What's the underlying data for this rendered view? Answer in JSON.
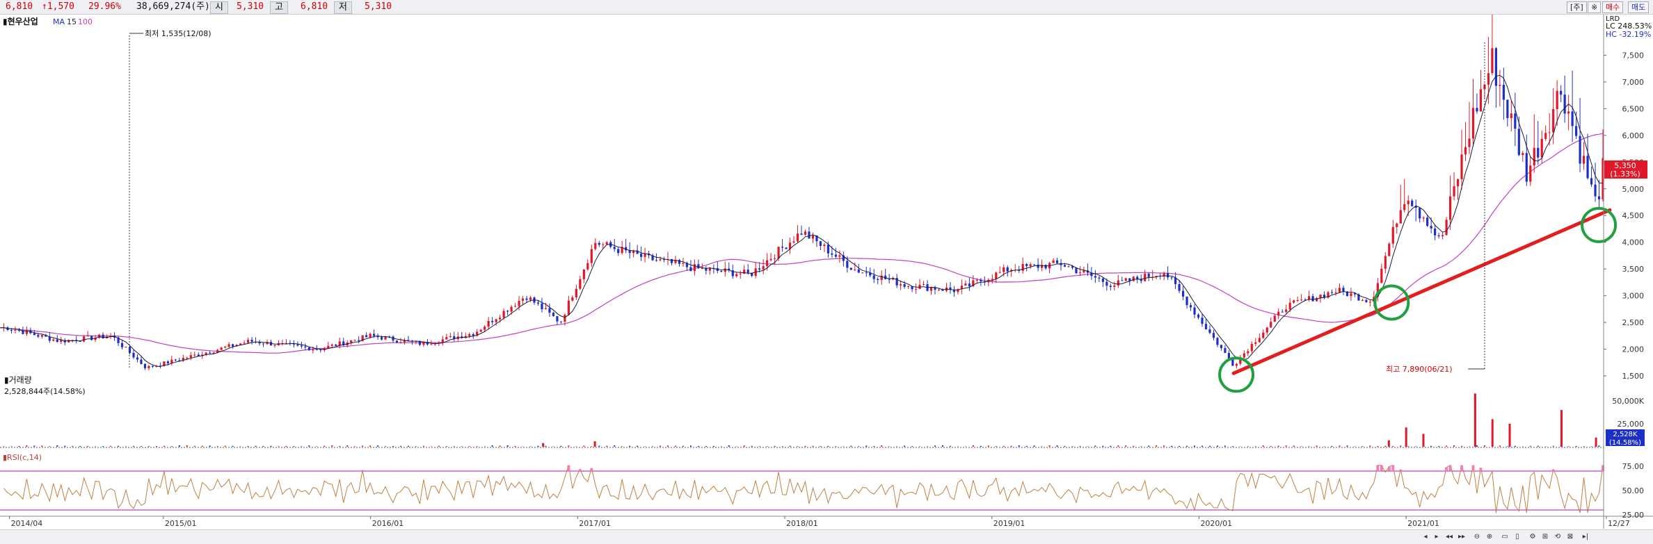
{
  "topbar": {
    "price": "6,810",
    "change": "↑1,570",
    "change_pct": "29.96%",
    "volume": "38,669,274(주)",
    "open_label": "시",
    "open": "5,310",
    "high_label": "고",
    "high": "6,810",
    "low_label": "저",
    "low": "5,310",
    "right_buttons": [
      "[주]",
      "※",
      "매수",
      "매도"
    ]
  },
  "chart_data": [
    {
      "type": "candlestick",
      "title": "▮현우산업",
      "ma_label": "MA",
      "ma_periods": [
        "15",
        "100"
      ],
      "ylim": [
        1500,
        8000
      ],
      "y_ticks": [
        "1,500",
        "2,000",
        "2,500",
        "3,000",
        "3,500",
        "4,000",
        "4,500",
        "5,000",
        "5,500",
        "6,000",
        "6,500",
        "7,000",
        "7,500"
      ],
      "x_ticks": [
        "2014/04",
        "2015/01",
        "2016/01",
        "2017/01",
        "2018/01",
        "2019/01",
        "2020/01",
        "2021/01",
        "12/27"
      ],
      "anchor_points": [
        {
          "d": "2014/04",
          "close": 2400
        },
        {
          "d": "2014/07",
          "close": 2150
        },
        {
          "d": "2014/10",
          "close": 2250
        },
        {
          "d": "2014/12",
          "close": 1650
        },
        {
          "d": "2015/03",
          "close": 1900
        },
        {
          "d": "2015/06",
          "close": 2150
        },
        {
          "d": "2015/10",
          "close": 2000
        },
        {
          "d": "2016/01",
          "close": 2250
        },
        {
          "d": "2016/04",
          "close": 2100
        },
        {
          "d": "2016/07",
          "close": 2300
        },
        {
          "d": "2016/10",
          "close": 3000
        },
        {
          "d": "2016/12",
          "close": 2500
        },
        {
          "d": "2017/02",
          "close": 4000
        },
        {
          "d": "2017/05",
          "close": 3700
        },
        {
          "d": "2017/08",
          "close": 3500
        },
        {
          "d": "2017/11",
          "close": 3400
        },
        {
          "d": "2018/02",
          "close": 4200
        },
        {
          "d": "2018/05",
          "close": 3500
        },
        {
          "d": "2018/08",
          "close": 3200
        },
        {
          "d": "2018/11",
          "close": 3100
        },
        {
          "d": "2019/02",
          "close": 3500
        },
        {
          "d": "2019/05",
          "close": 3600
        },
        {
          "d": "2019/08",
          "close": 3200
        },
        {
          "d": "2019/11",
          "close": 3450
        },
        {
          "d": "2020/03",
          "close": 1700
        },
        {
          "d": "2020/06",
          "close": 2800
        },
        {
          "d": "2020/09",
          "close": 3100
        },
        {
          "d": "2020/11",
          "close": 2900
        },
        {
          "d": "2021/01",
          "close": 5000
        },
        {
          "d": "2021/03",
          "close": 4000
        },
        {
          "d": "2021/05",
          "close": 6500
        },
        {
          "d": "2021/06",
          "close": 7400
        },
        {
          "d": "2021/08",
          "close": 5300
        },
        {
          "d": "2021/10",
          "close": 6900
        },
        {
          "d": "2021/12",
          "close": 4700
        },
        {
          "d": "2021/12/27",
          "close": 5350
        }
      ],
      "annotations": [
        {
          "text": "최저 1,535(12/08)"
        },
        {
          "text": "최고 7,890(06/21)"
        }
      ],
      "right_labels": [
        "LC 248.53%",
        "HC -32.19%",
        "LRD"
      ],
      "last_price": "5,350",
      "last_change": "(1.33%)",
      "trendline": {
        "from": {
          "d": "2020/03",
          "price": 1600
        },
        "to": {
          "d": "2021/12/27",
          "price": 4500
        },
        "color": "#e02020"
      },
      "highlight_circles": [
        {
          "d": "2020/03",
          "price": 1600
        },
        {
          "d": "2020/12",
          "price": 2950
        },
        {
          "d": "2021/12",
          "price": 4400
        }
      ],
      "colors": {
        "up": "#e0182a",
        "down": "#1c2fc7",
        "ma15": "#1a1a3a",
        "ma100": "#c040c0"
      }
    },
    {
      "type": "bar",
      "title": "▮거래량",
      "current": "2,528,844주(14.58%)",
      "y_ticks": [
        "50,000K",
        "25,000"
      ],
      "badge_value": "2,528K",
      "badge_pct": "(14.58%)",
      "spikes": [
        {
          "d": "2016/11",
          "value": 4000
        },
        {
          "d": "2017/02",
          "value": 6000
        },
        {
          "d": "2020/12",
          "value": 7000
        },
        {
          "d": "2021/01",
          "value": 21000
        },
        {
          "d": "2021/02",
          "value": 14000
        },
        {
          "d": "2021/05",
          "value": 58000
        },
        {
          "d": "2021/06",
          "value": 30000
        },
        {
          "d": "2021/07",
          "value": 25000
        },
        {
          "d": "2021/10",
          "value": 40000
        },
        {
          "d": "2021/12",
          "value": 10000
        }
      ]
    },
    {
      "type": "line",
      "title": "▮RSI(c,14)",
      "ylim": [
        25,
        75
      ],
      "y_ticks": [
        "75.00",
        "50.00",
        "25.00"
      ],
      "levels": [
        70,
        30
      ],
      "colors": {
        "line": "#c08040",
        "level": "#c040c0",
        "overbought_fill": "#f080b0"
      }
    }
  ],
  "bottombar": {
    "nav_icons": [
      "◂",
      "▸",
      "◂◂",
      "▸▸",
      "⊖",
      "⊕",
      "▭",
      "▯",
      "⚙",
      "⊞",
      "⟲",
      "⊠",
      "▸|"
    ]
  }
}
